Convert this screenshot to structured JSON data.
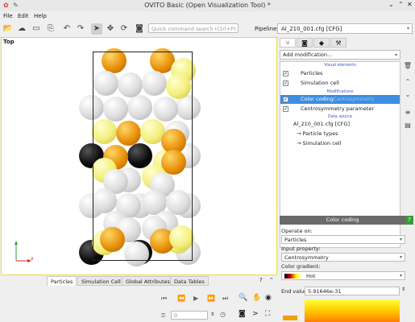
{
  "window": {
    "title": "OVITO Basic (Open Visualization Tool) *"
  },
  "menu": {
    "file": "File",
    "edit": "Edit",
    "help": "Help"
  },
  "toolbar": {
    "search_placeholder": "Quick command search (Ctrl+P)",
    "pipelines_label": "Pipelines:",
    "pipeline_selected": "Al_210_001.cfg [CFG]"
  },
  "viewport": {
    "label": "Top",
    "axis_x": "x",
    "atom_colors": {
      "white": "#dcdcdc",
      "orange": "#e8900a",
      "yellow": "#f3ee7a",
      "black": "#0c0c0c"
    }
  },
  "bottom_tabs": [
    "Particles",
    "Simulation Cell",
    "Global Attributes",
    "Data Tables"
  ],
  "anim": {
    "frame": "0"
  },
  "panel": {
    "add_modification": "Add modification...",
    "sections": {
      "visual": "Visual elements",
      "modifications": "Modifications",
      "data_source": "Data source"
    },
    "visual_items": [
      "Particles",
      "Simulation cell"
    ],
    "mod_items": [
      "Color coding",
      "Centrosymmetry parameter"
    ],
    "color_coding_status": "Centrosymmetry",
    "source_items": [
      "Al_210_001.cfg [CFG]",
      "→ Particle types",
      "→ Simulation cell"
    ],
    "cc_header": "Color coding",
    "help": "?",
    "operate_on_label": "Operate on:",
    "operate_on": "Particles",
    "input_property_label": "Input property:",
    "input_property": "Centrosymmetry",
    "gradient_label": "Color gradient:",
    "gradient": "Hot",
    "end_value_label": "End value:",
    "end_value": "5.91646e-31"
  }
}
